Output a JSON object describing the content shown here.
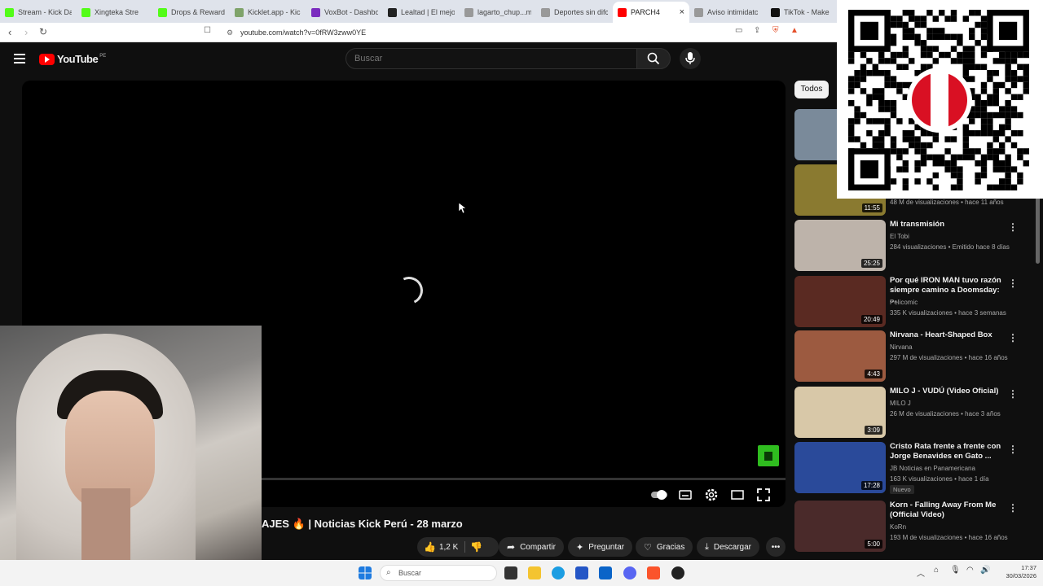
{
  "browser": {
    "tabs": [
      {
        "label": "Stream - Kick Da",
        "color": "#53fc18"
      },
      {
        "label": "Xingteka Stre",
        "color": "#53fc18"
      },
      {
        "label": "Drops & Reward",
        "color": "#53fc18"
      },
      {
        "label": "Kicklet.app - Kic",
        "color": "#7fa36a"
      },
      {
        "label": "VoxBot - Dashbo",
        "color": "#7b2cbf"
      },
      {
        "label": "Lealtad | El mejo",
        "color": "#222222"
      },
      {
        "label": "lagarto_chup...m",
        "color": "#999999"
      },
      {
        "label": "Deportes sin difc",
        "color": "#999999"
      },
      {
        "label": "PARCH4",
        "color": "#ff0000",
        "active": true
      },
      {
        "label": "Aviso intimidatc",
        "color": "#999999"
      },
      {
        "label": "TikTok - Make",
        "color": "#111111"
      }
    ],
    "url": "youtube.com/watch?v=0fRW3zww0YE"
  },
  "youtube": {
    "logo_text": "YouTube",
    "country_code": "PE",
    "search_placeholder": "Buscar"
  },
  "video": {
    "title": "AJES 🔥 | Noticias Kick Perú - 28 marzo",
    "likes": "1,2 K",
    "actions": {
      "share": "Compartir",
      "ask": "Preguntar",
      "thanks": "Gracias",
      "download": "Descargar"
    }
  },
  "sidebar": {
    "chip_all": "Todos",
    "recommendations": [
      {
        "title": "",
        "channel": "",
        "meta": "",
        "duration": "",
        "thumb_color": "#7a8a9a"
      },
      {
        "title": "",
        "channel": "",
        "meta": "48 M de visualizaciones • hace 11 años",
        "duration": "11:55",
        "thumb_color": "#8a7a30"
      },
      {
        "title": "Mi transmisión",
        "channel": "El Tobi",
        "meta": "284 visualizaciones • Emitido hace 8 días",
        "duration": "25:25",
        "thumb_color": "#bdb3aa"
      },
      {
        "title": "Por qué IRON MAN tuvo razón siempre camino a Doomsday: ...",
        "channel": "Pelicomic",
        "meta": "335 K visualizaciones • hace 3 semanas",
        "duration": "20:49",
        "thumb_color": "#5a2a22"
      },
      {
        "title": "Nirvana - Heart-Shaped Box",
        "channel": "Nirvana",
        "meta": "297 M de visualizaciones • hace 16 años",
        "duration": "4:43",
        "thumb_color": "#9c5a40"
      },
      {
        "title": "MILO J - VUDÚ (Video Oficial)",
        "channel": "MILO J",
        "meta": "26 M de visualizaciones • hace 3 años",
        "duration": "3:09",
        "thumb_color": "#d8c8a8"
      },
      {
        "title": "Cristo Rata frente a frente con Jorge Benavides en Gato ...",
        "channel": "JB Noticias en Panamericana",
        "meta": "163 K visualizaciones • hace 1 día",
        "duration": "17:28",
        "badge": "Nuevo",
        "thumb_color": "#2a4a9a"
      },
      {
        "title": "Korn - Falling Away From Me (Official Video)",
        "channel": "KoRn",
        "meta": "193 M de visualizaciones • hace 16 años",
        "duration": "5:00",
        "thumb_color": "#4a2a2a"
      }
    ]
  },
  "taskbar": {
    "search_placeholder": "Buscar",
    "time": "17:37",
    "date": "30/03/2026"
  }
}
